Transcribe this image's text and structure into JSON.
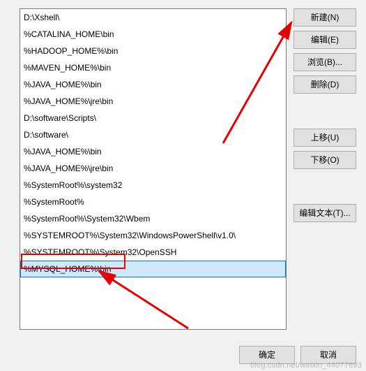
{
  "list": {
    "items": [
      "D:\\Xshell\\",
      "%CATALINA_HOME\\bin",
      "%HADOOP_HOME%\\bin",
      "%MAVEN_HOME%\\bin",
      "%JAVA_HOME%\\bin",
      "%JAVA_HOME%\\jre\\bin",
      "D:\\software\\Scripts\\",
      "D:\\software\\",
      "%JAVA_HOME%\\bin",
      "%JAVA_HOME%\\jre\\bin",
      "%SystemRoot%\\system32",
      "%SystemRoot%",
      "%SystemRoot%\\System32\\Wbem",
      "%SYSTEMROOT%\\System32\\WindowsPowerShell\\v1.0\\",
      "%SYSTEMROOT%\\System32\\OpenSSH",
      "%MYSQL_HOME%\\bin"
    ],
    "selected_index": 15
  },
  "buttons": {
    "new": "新建(N)",
    "edit": "编辑(E)",
    "browse": "浏览(B)...",
    "delete": "删除(D)",
    "move_up": "上移(U)",
    "move_down": "下移(O)",
    "edit_text": "编辑文本(T)...",
    "ok": "确定",
    "cancel": "取消"
  },
  "annotation": {
    "highlight_target": "%MYSQL_HOME%\\bin",
    "arrow_target_button": "new"
  },
  "watermark": "blog.csdn.net/weixin_44077693"
}
